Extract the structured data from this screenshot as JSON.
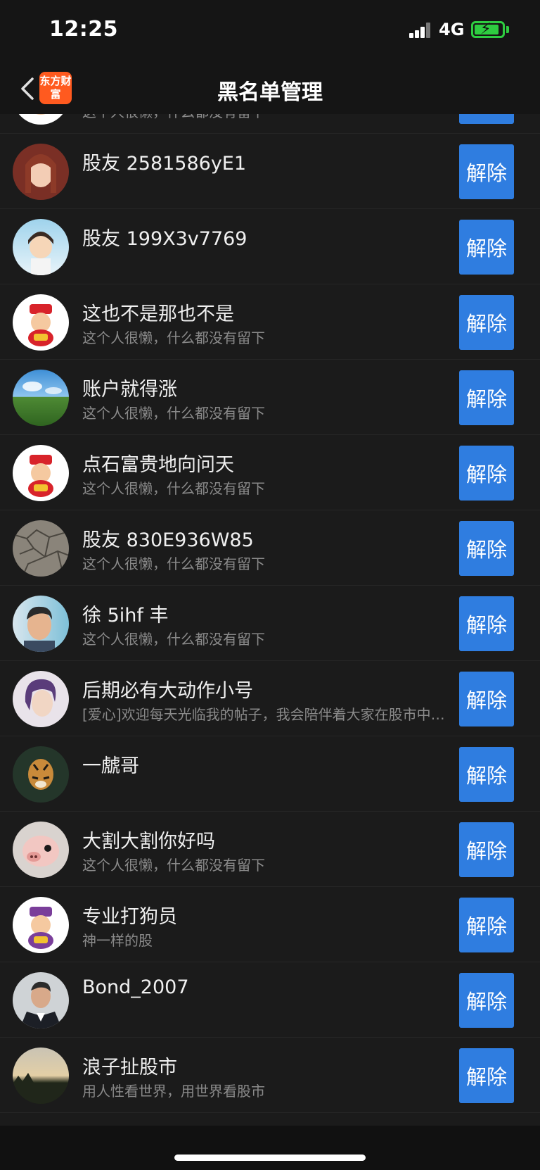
{
  "status_bar": {
    "time": "12:25",
    "network": "4G",
    "battery_level": 0.8
  },
  "nav": {
    "title": "黑名单管理",
    "logo_text": "东方财富",
    "back_icon": "chevron-left-icon"
  },
  "colors": {
    "accent": "#2f7de0",
    "brand": "#ff5a1f",
    "background": "#1b1b1b"
  },
  "unblock_label": "解除",
  "partial_top_row": {
    "signature": "这个人很懒，什么都没有留下"
  },
  "users": [
    {
      "name": "股友 2581586yE1",
      "signature": "",
      "avatar": "anime-girl-avatar"
    },
    {
      "name": "股友 199X3v7769",
      "signature": "",
      "avatar": "anime-boy-avatar"
    },
    {
      "name": "这也不是那也不是",
      "signature": "这个人很懒，什么都没有留下",
      "avatar": "fortune-god-avatar"
    },
    {
      "name": "账户就得涨",
      "signature": "这个人很懒，什么都没有留下",
      "avatar": "landscape-avatar"
    },
    {
      "name": "点石富贵地向问天",
      "signature": "这个人很懒，什么都没有留下",
      "avatar": "fortune-god-avatar"
    },
    {
      "name": "股友 830E936W85",
      "signature": "这个人很懒，什么都没有留下",
      "avatar": "cracked-earth-avatar"
    },
    {
      "name": "徐 5ihf 丰",
      "signature": "这个人很懒，什么都没有留下",
      "avatar": "cartoon-man-avatar"
    },
    {
      "name": "后期必有大动作小号",
      "signature": "[爱心]欢迎每天光临我的帖子，我会陪伴着大家在股市中成长",
      "avatar": "anime-man-avatar"
    },
    {
      "name": "一虤哥",
      "signature": "",
      "avatar": "tiger-avatar"
    },
    {
      "name": "大割大割你好吗",
      "signature": "这个人很懒，什么都没有留下",
      "avatar": "pig-avatar"
    },
    {
      "name": "专业打狗员",
      "signature": "神一样的股",
      "avatar": "fortune-god-purple-avatar"
    },
    {
      "name": "Bond_2007",
      "signature": "",
      "avatar": "man-in-suit-avatar"
    },
    {
      "name": "浪子扯股市",
      "signature": "用人性看世界，用世界看股市",
      "avatar": "sunset-avatar"
    }
  ]
}
